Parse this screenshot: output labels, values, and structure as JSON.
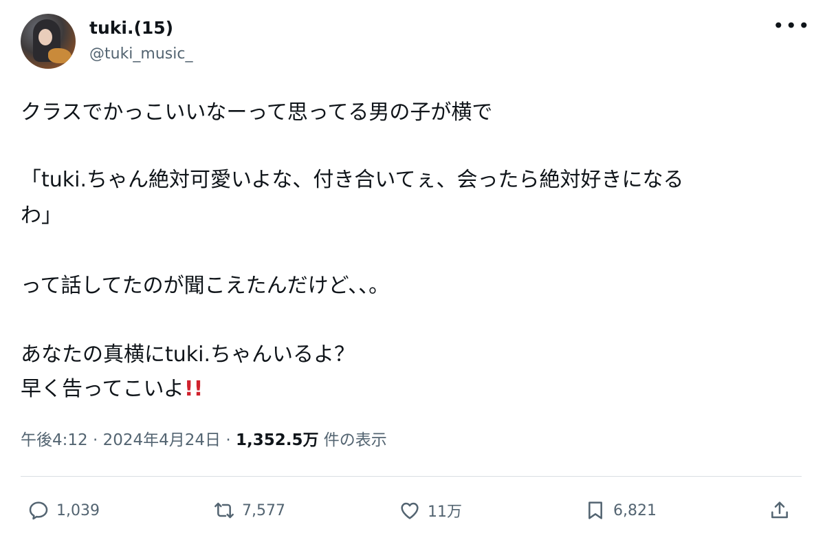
{
  "author": {
    "display_name": "tuki.(15)",
    "handle": "@tuki_music_"
  },
  "more_menu": "•••",
  "tweet": {
    "lines": [
      "クラスでかっこいいなーって思ってる男の子が横で",
      "「tuki.ちゃん絶対可愛いよな、付き合いてぇ、会ったら絶対好きになる",
      "わ」",
      "って話してたのが聞こえたんだけど、、。",
      "あなたの真横にtuki.ちゃんいるよ？",
      "早く告ってこいよ"
    ],
    "emoji": "!!"
  },
  "meta": {
    "time": "午後4:12",
    "separator": "·",
    "date": "2024年4月24日",
    "views_count": "1,352.5万",
    "views_label": "件の表示"
  },
  "actions": {
    "replies": "1,039",
    "reposts": "7,577",
    "likes": "11万",
    "bookmarks": "6,821"
  },
  "icons": {
    "reply": "reply-icon",
    "repost": "repost-icon",
    "like": "heart-icon",
    "bookmark": "bookmark-icon",
    "share": "share-icon"
  },
  "colors": {
    "text": "#0f1419",
    "secondary": "#536471",
    "emoji_red": "#d0222d"
  }
}
